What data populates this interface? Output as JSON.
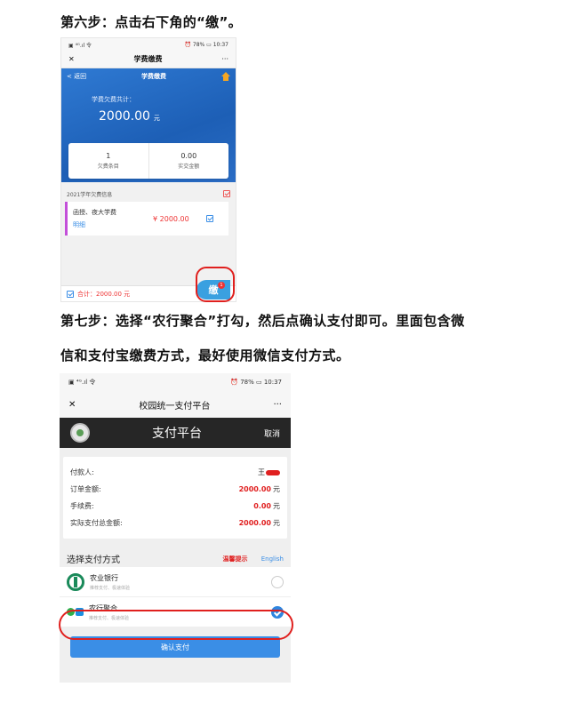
{
  "step6": "第六步：点击右下角的“缴”。",
  "step7_line1": "第七步：选择“农行聚合”打勾，然后点确认支付即可。里面包含微",
  "step7_line2": "信和支付宝缴费方式，最好使用微信支付方式。",
  "shot1": {
    "status_left": "▣ ⁴ᴳ.ıl 令",
    "status_right": "⏰ 78% ▭ 10:37",
    "close": "✕",
    "title": "学费缴费",
    "more": "···",
    "back": "< 返回",
    "nav_title": "学费缴费",
    "owed_label": "学费欠费共计：",
    "amount": "2000.00",
    "unit": "元",
    "count": "1",
    "count_label": "欠费条目",
    "paid": "0.00",
    "paid_label": "实交金额",
    "year_label": "2021学年欠费信息",
    "item_name": "函授、夜大学费",
    "item_detail": "明细",
    "item_price": "¥ 2000.00",
    "total": "合计：2000.00 元",
    "pay_char": "缴",
    "badge": "1"
  },
  "shot2": {
    "status_left": "▣ ⁴ᴳ.ıl 令",
    "status_right": "⏰ 78% ▭ 10:37",
    "close": "✕",
    "title": "校园统一支付平台",
    "more": "···",
    "header_title": "支付平台",
    "cancel": "取消",
    "payer_label": "付款人:",
    "payer_value": "王",
    "order_label": "订单金额:",
    "order_value": "2000.00",
    "fee_label": "手续费:",
    "fee_value": "0.00",
    "total_label": "实际支付总金额:",
    "total_value": "2000.00",
    "yuan": "元",
    "method_header": "选择支付方式",
    "tip": "温馨提示",
    "english": "English",
    "opt1_name": "农业银行",
    "opt1_sub": "推荐支付、极速体验",
    "opt2_name": "农行聚合",
    "opt2_sub": "推荐支付、极速体验",
    "confirm": "确认支付"
  }
}
